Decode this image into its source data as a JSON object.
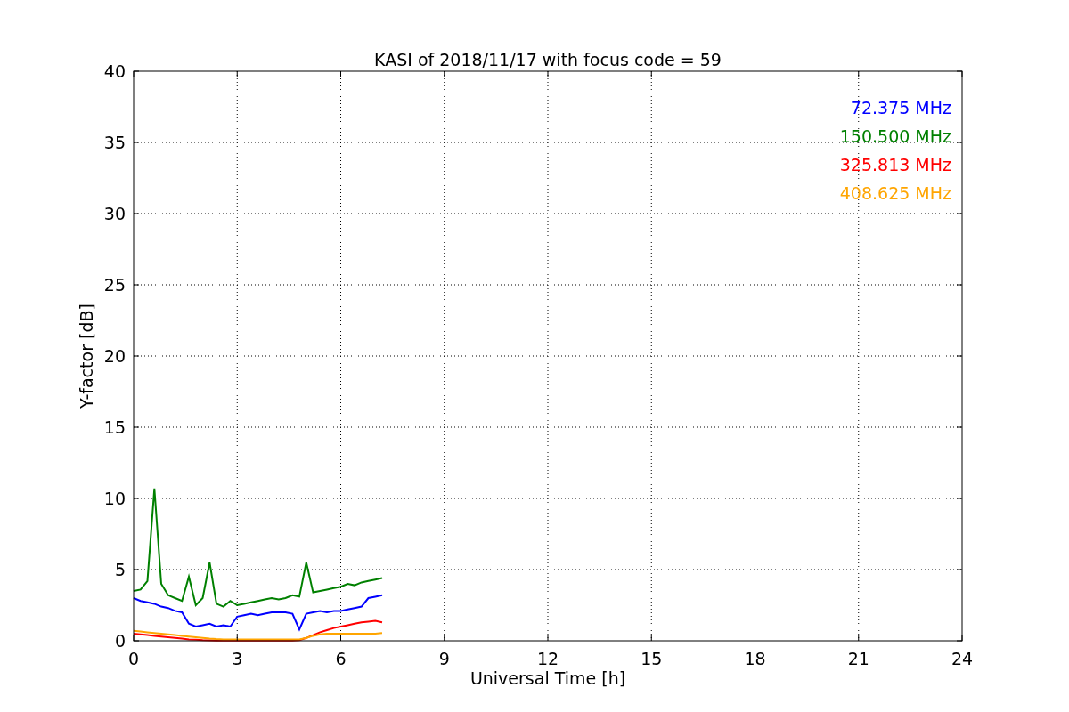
{
  "chart_data": {
    "type": "line",
    "title": "KASI of 2018/11/17 with focus code = 59",
    "xlabel": "Universal Time [h]",
    "ylabel": "Y-factor [dB]",
    "x": [
      0,
      0.2,
      0.4,
      0.6,
      0.8,
      1,
      1.2,
      1.4,
      1.6,
      1.8,
      2,
      2.2,
      2.4,
      2.6,
      2.8,
      3,
      3.2,
      3.4,
      3.6,
      3.8,
      4,
      4.2,
      4.4,
      4.6,
      4.8,
      5,
      5.2,
      5.4,
      5.6,
      5.8,
      6,
      6.2,
      6.4,
      6.6,
      6.8,
      7,
      7.2
    ],
    "series": [
      {
        "name": "72.375 MHz",
        "color": "#0000ff",
        "values": [
          3.0,
          2.8,
          2.7,
          2.6,
          2.4,
          2.3,
          2.1,
          2.0,
          1.2,
          1.0,
          1.1,
          1.2,
          1.0,
          1.1,
          1.0,
          1.7,
          1.8,
          1.9,
          1.8,
          1.9,
          2.0,
          2.0,
          2.0,
          1.9,
          0.8,
          1.9,
          2.0,
          2.1,
          2.0,
          2.1,
          2.1,
          2.2,
          2.3,
          2.4,
          3.0,
          3.1,
          3.2
        ]
      },
      {
        "name": "150.500 MHz",
        "color": "#008000",
        "values": [
          3.5,
          3.6,
          4.2,
          10.7,
          4.0,
          3.2,
          3.0,
          2.8,
          4.5,
          2.5,
          3.0,
          5.5,
          2.6,
          2.4,
          2.8,
          2.5,
          2.6,
          2.7,
          2.8,
          2.9,
          3.0,
          2.9,
          3.0,
          3.2,
          3.1,
          5.5,
          3.4,
          3.5,
          3.6,
          3.7,
          3.8,
          4.0,
          3.9,
          4.1,
          4.2,
          4.3,
          4.4
        ]
      },
      {
        "name": "325.813 MHz",
        "color": "#ff0000",
        "values": [
          0.5,
          0.45,
          0.4,
          0.35,
          0.3,
          0.25,
          0.2,
          0.15,
          0.1,
          0.08,
          0.05,
          0.03,
          0.02,
          0.02,
          0.02,
          0.02,
          0.02,
          0.02,
          0.02,
          0.02,
          0.02,
          0.02,
          0.02,
          0.02,
          0.05,
          0.2,
          0.4,
          0.6,
          0.75,
          0.9,
          1.0,
          1.1,
          1.2,
          1.3,
          1.35,
          1.4,
          1.3
        ]
      },
      {
        "name": "408.625 MHz",
        "color": "#ffa500",
        "values": [
          0.7,
          0.65,
          0.6,
          0.55,
          0.5,
          0.45,
          0.4,
          0.35,
          0.3,
          0.25,
          0.2,
          0.15,
          0.12,
          0.1,
          0.1,
          0.1,
          0.1,
          0.1,
          0.1,
          0.1,
          0.1,
          0.1,
          0.1,
          0.1,
          0.1,
          0.2,
          0.35,
          0.45,
          0.5,
          0.5,
          0.5,
          0.5,
          0.5,
          0.5,
          0.5,
          0.5,
          0.55
        ]
      }
    ],
    "grid": true,
    "xlim": [
      0,
      24
    ],
    "ylim": [
      0,
      40
    ],
    "xticks": [
      0,
      3,
      6,
      9,
      12,
      15,
      18,
      21,
      24
    ],
    "yticks": [
      0,
      5,
      10,
      15,
      20,
      25,
      30,
      35,
      40
    ]
  }
}
